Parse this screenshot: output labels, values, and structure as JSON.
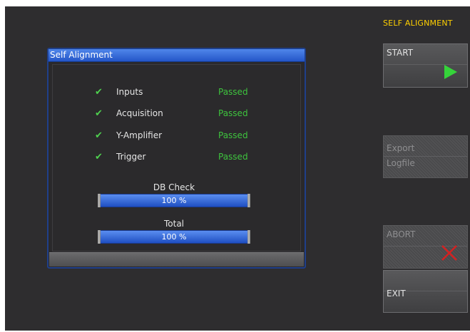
{
  "dialog": {
    "title": "Self Alignment",
    "rows": [
      {
        "label": "Inputs",
        "status": "Passed"
      },
      {
        "label": "Acquisition",
        "status": "Passed"
      },
      {
        "label": "Y-Amplifier",
        "status": "Passed"
      },
      {
        "label": "Trigger",
        "status": "Passed"
      }
    ],
    "progress": [
      {
        "label": "DB Check",
        "value_text": "100 %",
        "value": 1.0
      },
      {
        "label": "Total",
        "value_text": "100 %",
        "value": 1.0
      }
    ]
  },
  "softkeys": {
    "title": "SELF ALIGNMENT",
    "start": {
      "label": "START"
    },
    "export": {
      "line1": "Export",
      "line2": "Logfile"
    },
    "abort": {
      "label": "ABORT"
    },
    "exit": {
      "label": "EXIT"
    }
  },
  "colors": {
    "accent_title": "#ffd000",
    "passed": "#3ec43e",
    "check": "#4fd14f",
    "progress": "#2b5fd8"
  },
  "icons": [
    "checkmark-icon",
    "play-icon",
    "abort-x-icon"
  ]
}
